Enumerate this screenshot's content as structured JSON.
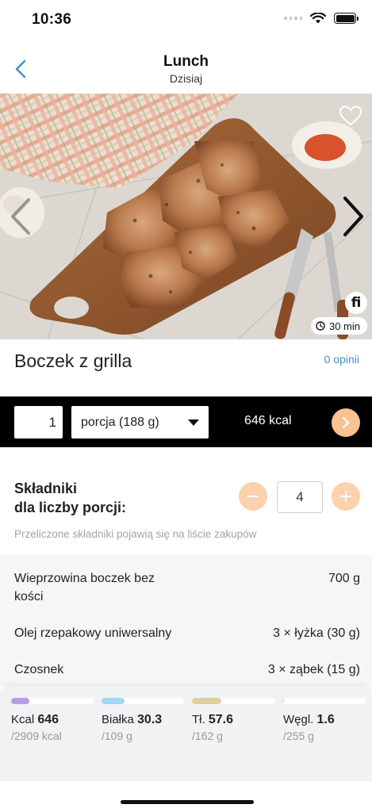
{
  "status_bar": {
    "time": "10:36"
  },
  "header": {
    "title": "Lunch",
    "subtitle": "Dzisiaj"
  },
  "hero": {
    "badge_time": "30 min",
    "logo_text": "fi"
  },
  "recipe": {
    "title": "Boczek z grilla",
    "reviews": "0 opinii"
  },
  "portion": {
    "quantity": "1",
    "unit": "porcja (188 g)",
    "kcal": "646 kcal"
  },
  "ingredients": {
    "title_line1": "Składniki",
    "title_line2": "dla liczby porcji:",
    "servings": "4",
    "hint": "Przeliczone składniki pojawią się na liście zakupów",
    "items": [
      {
        "name_line1": "Wieprzowina boczek bez",
        "name_line2": "kości",
        "amount": "700 g"
      },
      {
        "name_line1": "Olej rzepakowy uniwersalny",
        "name_line2": "",
        "amount": "3 × łyżka (30 g)"
      },
      {
        "name_line1": "Czosnek",
        "name_line2": "",
        "amount": "3 × ząbek (15 g)"
      }
    ]
  },
  "nutrition": [
    {
      "label": "Kcal",
      "value": "646",
      "target": "/2909 kcal",
      "fraction": 0.22,
      "color": "#b79ee0"
    },
    {
      "label": "Białka",
      "value": "30.3",
      "target": "/109 g",
      "fraction": 0.28,
      "color": "#9fd8f0"
    },
    {
      "label": "Tł.",
      "value": "57.6",
      "target": "/162 g",
      "fraction": 0.36,
      "color": "#ddd09a"
    },
    {
      "label": "Węgl.",
      "value": "1.6",
      "target": "/255 g",
      "fraction": 0.01,
      "color": "#c8c8c8"
    }
  ],
  "colors": {
    "accent": "#f9c292",
    "accent_light": "#fbd2ad",
    "link": "#4a90c8",
    "portion_bar": "#000000"
  },
  "icons": [
    "back-chevron-icon",
    "heart-icon",
    "chevron-left-icon",
    "chevron-right-icon",
    "clock-icon",
    "minus-icon",
    "plus-icon",
    "arrow-right-icon"
  ]
}
